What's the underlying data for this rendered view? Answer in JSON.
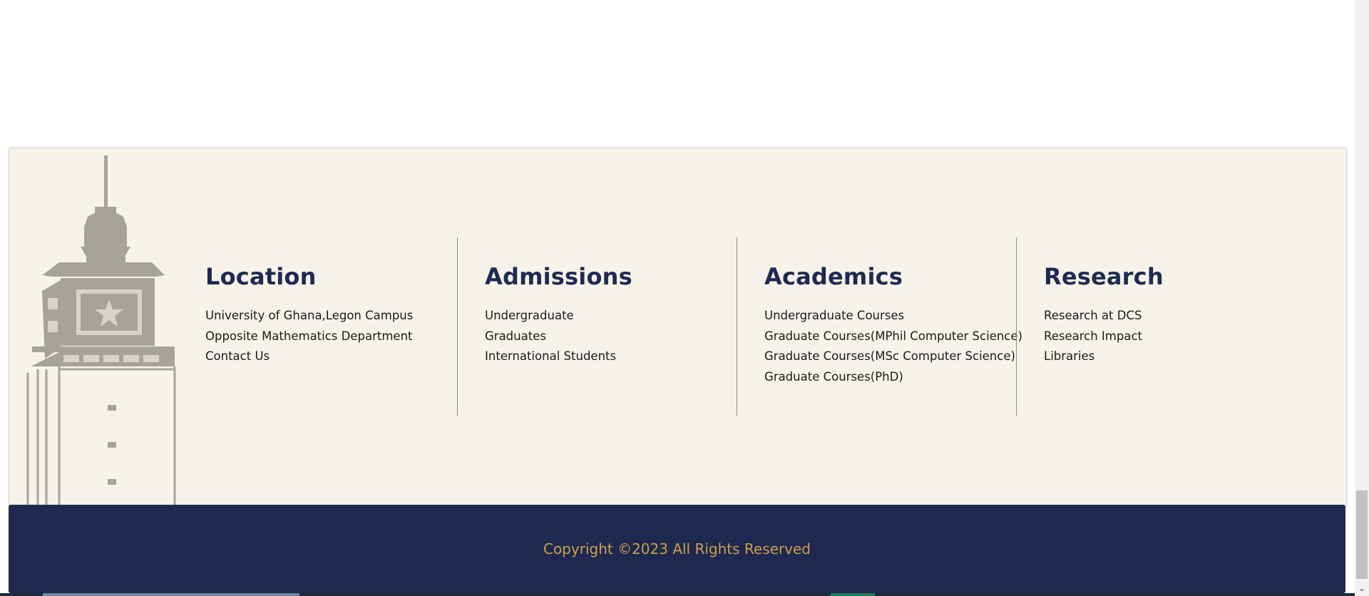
{
  "footer": {
    "columns": [
      {
        "heading": "Location",
        "links": [
          "University of Ghana,Legon Campus",
          "Opposite Mathematics Department",
          "Contact Us"
        ]
      },
      {
        "heading": "Admissions",
        "links": [
          "Undergraduate",
          "Graduates",
          "International Students"
        ]
      },
      {
        "heading": "Academics",
        "links": [
          "Undergraduate Courses",
          "Graduate Courses(MPhil Computer Science)",
          "Graduate Courses(MSc Computer Science)",
          "Graduate Courses(PhD)"
        ]
      },
      {
        "heading": "Research",
        "links": [
          "Research at DCS",
          "Research Impact",
          "Libraries"
        ]
      }
    ],
    "copyright": "Copyright ©2023 All Rights Reserved"
  },
  "colors": {
    "footer_background": "#f7f3ea",
    "heading": "#1f2a52",
    "copyright_bar": "#1f2850",
    "copyright_text": "#c9a24a",
    "tower_illustration": "#a6a39a"
  },
  "icons": {
    "tower": "balme-library-clock-tower-illustration",
    "scroll_down": "chevron-down-icon"
  }
}
